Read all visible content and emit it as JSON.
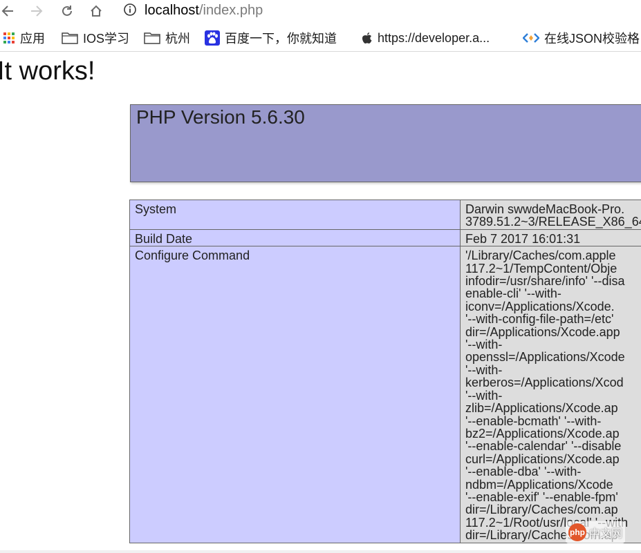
{
  "browser": {
    "url_host": "localhost",
    "url_path": "/index.php"
  },
  "bookmarks": [
    {
      "label": "应用",
      "icon": "apps-grid-icon"
    },
    {
      "label": "IOS学习",
      "icon": "folder-icon"
    },
    {
      "label": "杭州",
      "icon": "folder-icon"
    },
    {
      "label": "百度一下，你就知道",
      "icon": "baidu-paw-icon"
    },
    {
      "label": "https://developer.a...",
      "icon": "apple-icon"
    },
    {
      "label": "在线JSON校验格",
      "icon": "code-diamond-icon"
    }
  ],
  "page": {
    "heading": "It works!",
    "php_version_title": "PHP Version 5.6.30"
  },
  "info_rows": [
    {
      "key": "System",
      "value": "Darwin swwdeMacBook-Pro.\n3789.51.2~3/RELEASE_X86_64"
    },
    {
      "key": "Build Date",
      "value": "Feb 7 2017 16:01:31"
    },
    {
      "key": "Configure Command",
      "value": "'/Library/Caches/com.apple\n117.2~1/TempContent/Obje\ninfodir=/usr/share/info' '--disa\nenable-cli' '--with-\niconv=/Applications/Xcode.\n'--with-config-file-path=/etc'\ndir=/Applications/Xcode.app\n'--with-\nopenssl=/Applications/Xcode\n'--with-\nkerberos=/Applications/Xcod\n'--with-\nzlib=/Applications/Xcode.ap\n'--enable-bcmath' '--with-\nbz2=/Applications/Xcode.ap\n'--enable-calendar' '--disable\ncurl=/Applications/Xcode.ap\n'--enable-dba' '--with-\nndbm=/Applications/Xcode\n'--enable-exif' '--enable-fpm'\ndir=/Library/Caches/com.ap\n117.2~1/Root/usr/local' '--with\ndir=/Library/Caches/com.ap"
    }
  ],
  "watermark": {
    "logo": "php",
    "text": "中文网"
  },
  "colors": {
    "php_header": "#9999cc",
    "key_cell": "#ccccff",
    "value_cell": "#dddddd"
  }
}
